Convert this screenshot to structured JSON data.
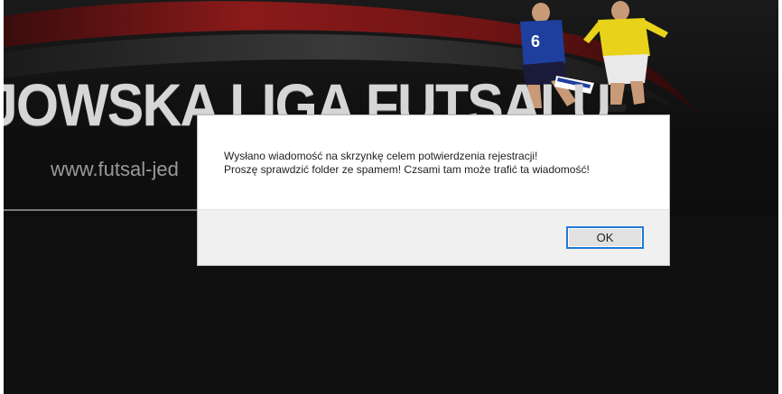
{
  "site": {
    "league_title": "JOWSKA LIGA FUTSALU",
    "website_url": "www.futsal-jed",
    "colors": {
      "background": "#101010",
      "swoosh": "#8b1a1a"
    }
  },
  "dialog": {
    "message_line1": "Wysłano wiadomość na skrzynkę celem potwierdzenia rejestracji!",
    "message_line2": "Proszę sprawdzić folder ze spamem! Czsami tam może trafić ta wiadomość!",
    "ok_label": "OK",
    "colors": {
      "focus_border": "#1f7ad6",
      "footer": "#f0f0f0"
    }
  }
}
